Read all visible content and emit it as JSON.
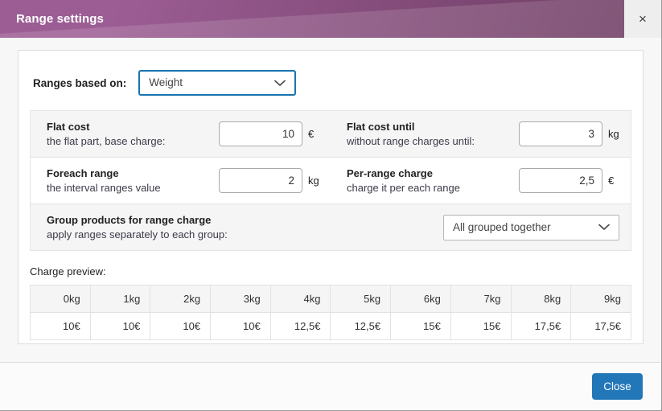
{
  "dialog": {
    "title": "Range settings",
    "close_icon": "close-icon",
    "close_icon_glyph": "×",
    "accent_purple": "#9c5d94",
    "accent_purple_dark": "#6e3d63",
    "accent_blue": "#2277b8",
    "focus_blue": "#1a74b0"
  },
  "based_on": {
    "label": "Ranges based on:",
    "value": "Weight",
    "chevron_icon": "chevron-down-icon",
    "chevron_glyph": "⌄"
  },
  "settings": {
    "rows": [
      {
        "left": {
          "title": "Flat cost",
          "subtitle": "the flat part, base charge:",
          "value": "10",
          "unit": "€"
        },
        "right": {
          "title": "Flat cost until",
          "subtitle": "without range charges until:",
          "value": "3",
          "unit": "kg"
        }
      },
      {
        "left": {
          "title": "Foreach range",
          "subtitle": "the interval ranges value",
          "value": "2",
          "unit": "kg"
        },
        "right": {
          "title": "Per-range charge",
          "subtitle": "charge it per each range",
          "value": "2,5",
          "unit": "€"
        }
      }
    ],
    "group_row": {
      "title": "Group products for range charge",
      "subtitle": "apply ranges separately to each group:",
      "value": "All grouped together",
      "chevron_icon": "chevron-down-icon",
      "chevron_glyph": "⌄"
    }
  },
  "preview": {
    "title": "Charge preview:",
    "headers": [
      "0kg",
      "1kg",
      "2kg",
      "3kg",
      "4kg",
      "5kg",
      "6kg",
      "7kg",
      "8kg",
      "9kg"
    ],
    "values": [
      "10€",
      "10€",
      "10€",
      "10€",
      "12,5€",
      "12,5€",
      "15€",
      "15€",
      "17,5€",
      "17,5€"
    ]
  },
  "footer": {
    "close_label": "Close"
  }
}
